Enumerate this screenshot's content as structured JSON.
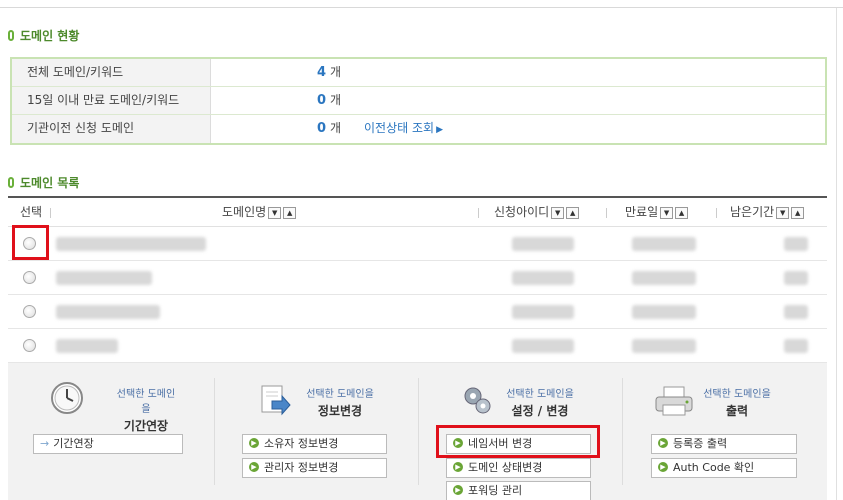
{
  "status_section": {
    "title": "도메인 현황",
    "rows": [
      {
        "label": "전체 도메인/키워드",
        "count": "4",
        "unit": "개",
        "link": ""
      },
      {
        "label": "15일 이내 만료 도메인/키워드",
        "count": "0",
        "unit": "개",
        "link": ""
      },
      {
        "label": "기관이전 신청 도메인",
        "count": "0",
        "unit": "개",
        "link": "이전상태 조회"
      }
    ]
  },
  "list_section": {
    "title": "도메인 목록",
    "columns": {
      "select": "선택",
      "domain": "도메인명",
      "applicant": "신청아이디",
      "expiry": "만료일",
      "remaining": "남은기간"
    }
  },
  "actions": {
    "extend": {
      "sub": "선택한 도메인을",
      "main": "기간연장",
      "buttons": [
        "기간연장"
      ]
    },
    "info": {
      "sub": "선택한 도메인을",
      "main": "정보변경",
      "buttons": [
        "소유자 정보변경",
        "관리자 정보변경"
      ]
    },
    "settings": {
      "sub": "선택한 도메인을",
      "main": "설정 / 변경",
      "buttons": [
        "네임서버 변경",
        "도메인 상태변경",
        "포워딩 관리"
      ]
    },
    "print": {
      "sub": "선택한 도메인을",
      "main": "출력",
      "buttons": [
        "등록증 출력",
        "Auth Code 확인"
      ]
    }
  },
  "colors": {
    "accent_green": "#6aa536",
    "link_blue": "#2b76c0",
    "highlight_red": "#e0101a"
  }
}
